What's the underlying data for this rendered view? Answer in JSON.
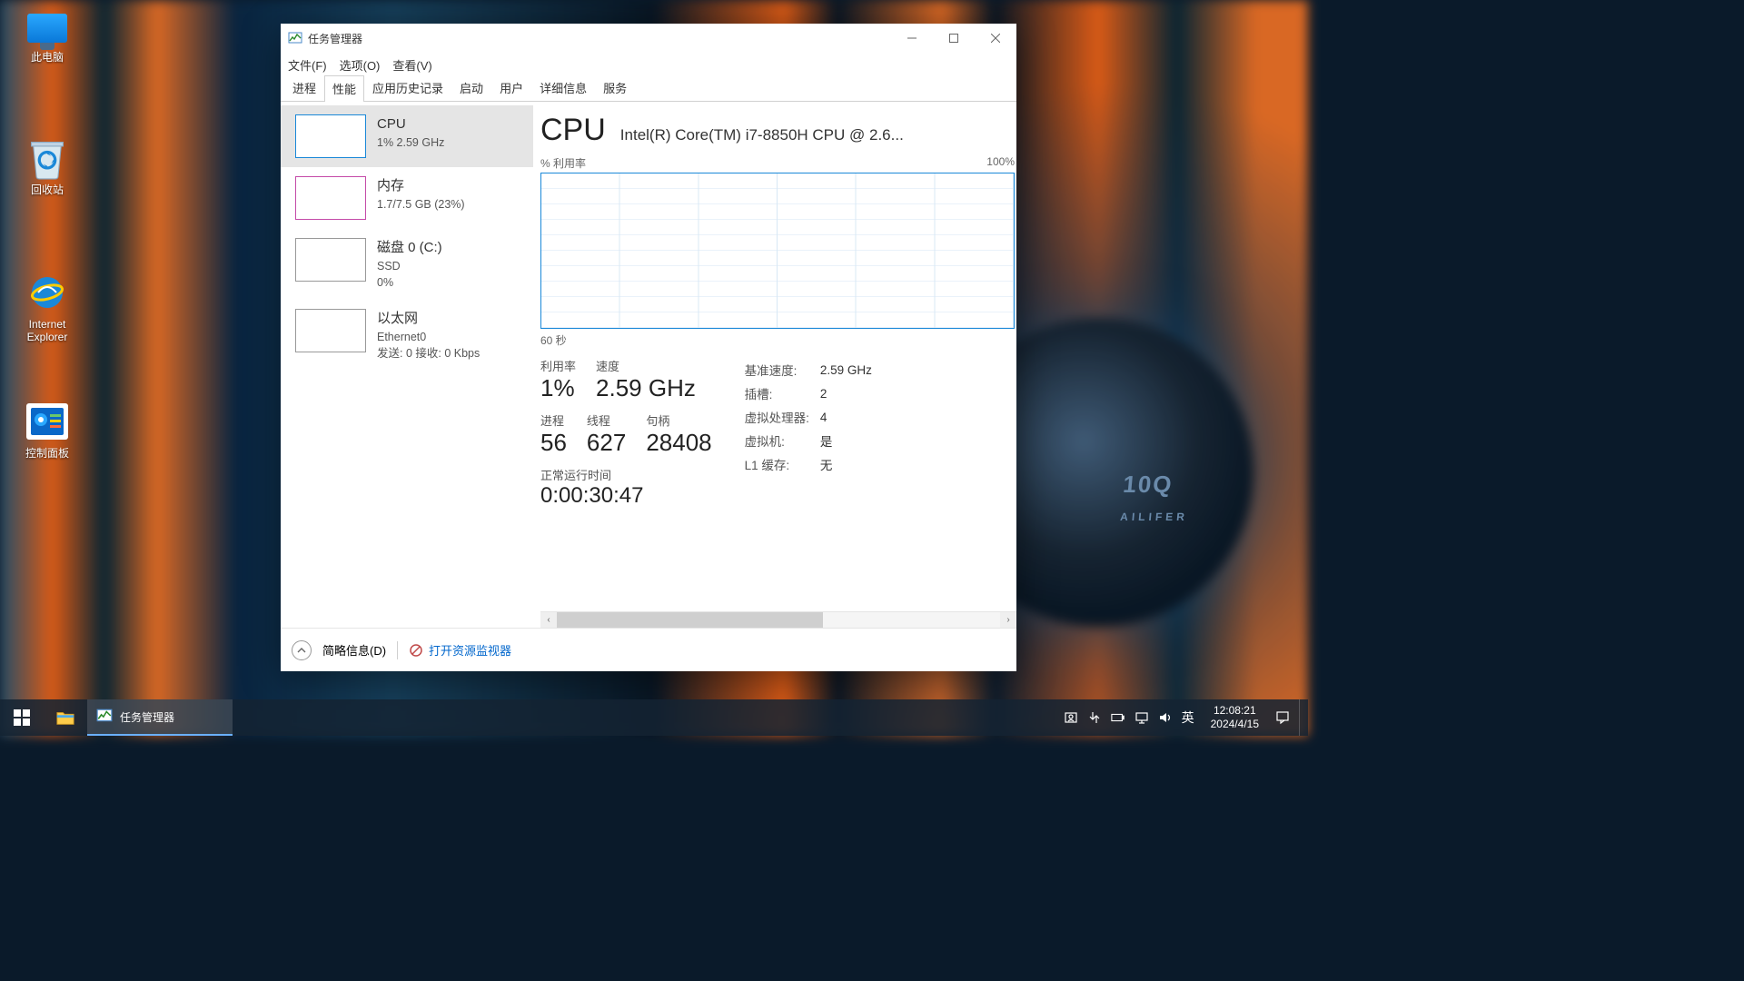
{
  "desktop": {
    "icons": {
      "this_pc": "此电脑",
      "recycle_bin": "回收站",
      "ie": "Internet Explorer",
      "control_panel": "控制面板"
    }
  },
  "window": {
    "title": "任务管理器",
    "menu": {
      "file": "文件(F)",
      "options": "选项(O)",
      "view": "查看(V)"
    },
    "tabs": {
      "processes": "进程",
      "performance": "性能",
      "app_history": "应用历史记录",
      "startup": "启动",
      "users": "用户",
      "details": "详细信息",
      "services": "服务"
    }
  },
  "sidebar": {
    "cpu": {
      "name": "CPU",
      "sub": "1%  2.59 GHz"
    },
    "mem": {
      "name": "内存",
      "sub": "1.7/7.5 GB (23%)"
    },
    "disk": {
      "name": "磁盘 0 (C:)",
      "sub1": "SSD",
      "sub2": "0%"
    },
    "net": {
      "name": "以太网",
      "sub1": "Ethernet0",
      "sub2": "发送: 0  接收: 0 Kbps"
    }
  },
  "main": {
    "heading": "CPU",
    "model": "Intel(R) Core(TM) i7-8850H CPU @ 2.6...",
    "chart": {
      "label_left": "% 利用率",
      "label_right": "100%",
      "bottom": "60 秒"
    },
    "big": {
      "util_l": "利用率",
      "util_v": "1%",
      "speed_l": "速度",
      "speed_v": "2.59 GHz",
      "proc_l": "进程",
      "proc_v": "56",
      "thread_l": "线程",
      "thread_v": "627",
      "handle_l": "句柄",
      "handle_v": "28408",
      "uptime_l": "正常运行时间",
      "uptime_v": "0:00:30:47"
    },
    "small": {
      "base_l": "基准速度:",
      "base_v": "2.59 GHz",
      "sockets_l": "插槽:",
      "sockets_v": "2",
      "vproc_l": "虚拟处理器:",
      "vproc_v": "4",
      "vm_l": "虚拟机:",
      "vm_v": "是",
      "l1_l": "L1 缓存:",
      "l1_v": "无"
    }
  },
  "footer": {
    "fewer": "简略信息(D)",
    "resmon": "打开资源监视器"
  },
  "taskbar": {
    "app": "任务管理器",
    "ime": "英",
    "time": "12:08:21",
    "date": "2024/4/15"
  },
  "chart_data": {
    "type": "line",
    "title": "% 利用率",
    "xlabel": "60 秒",
    "ylabel": "% 利用率",
    "ylim": [
      0,
      100
    ],
    "x": [
      0,
      10,
      20,
      30,
      40,
      50,
      60
    ],
    "series": [
      {
        "name": "CPU",
        "values": [
          1,
          1,
          1,
          1,
          1,
          1,
          1
        ]
      }
    ]
  }
}
